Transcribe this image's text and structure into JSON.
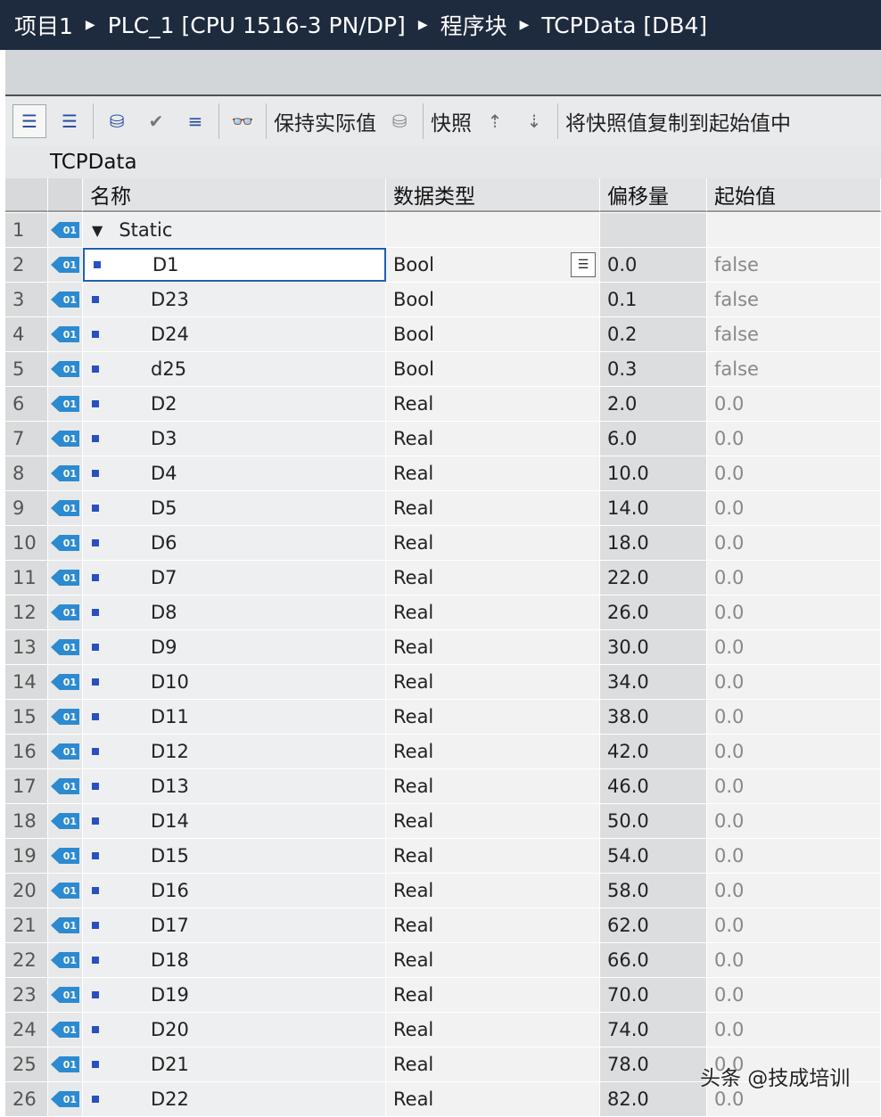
{
  "breadcrumb": [
    "项目1",
    "PLC_1 [CPU 1516-3 PN/DP]",
    "程序块",
    "TCPData [DB4]"
  ],
  "toolbar": {
    "keep_actual": "保持实际值",
    "snapshot": "快照",
    "copy_snapshot": "将快照值复制到起始值中"
  },
  "block_name": "TCPData",
  "columns": {
    "name": "名称",
    "type": "数据类型",
    "offset": "偏移量",
    "start": "起始值"
  },
  "rows": [
    {
      "n": "1",
      "name": "Static",
      "type": "",
      "offset": "",
      "start": ""
    },
    {
      "n": "2",
      "name": "D1",
      "type": "Bool",
      "offset": "0.0",
      "start": "false"
    },
    {
      "n": "3",
      "name": "D23",
      "type": "Bool",
      "offset": "0.1",
      "start": "false"
    },
    {
      "n": "4",
      "name": "D24",
      "type": "Bool",
      "offset": "0.2",
      "start": "false"
    },
    {
      "n": "5",
      "name": "d25",
      "type": "Bool",
      "offset": "0.3",
      "start": "false"
    },
    {
      "n": "6",
      "name": "D2",
      "type": "Real",
      "offset": "2.0",
      "start": "0.0"
    },
    {
      "n": "7",
      "name": "D3",
      "type": "Real",
      "offset": "6.0",
      "start": "0.0"
    },
    {
      "n": "8",
      "name": "D4",
      "type": "Real",
      "offset": "10.0",
      "start": "0.0"
    },
    {
      "n": "9",
      "name": "D5",
      "type": "Real",
      "offset": "14.0",
      "start": "0.0"
    },
    {
      "n": "10",
      "name": "D6",
      "type": "Real",
      "offset": "18.0",
      "start": "0.0"
    },
    {
      "n": "11",
      "name": "D7",
      "type": "Real",
      "offset": "22.0",
      "start": "0.0"
    },
    {
      "n": "12",
      "name": "D8",
      "type": "Real",
      "offset": "26.0",
      "start": "0.0"
    },
    {
      "n": "13",
      "name": "D9",
      "type": "Real",
      "offset": "30.0",
      "start": "0.0"
    },
    {
      "n": "14",
      "name": "D10",
      "type": "Real",
      "offset": "34.0",
      "start": "0.0"
    },
    {
      "n": "15",
      "name": "D11",
      "type": "Real",
      "offset": "38.0",
      "start": "0.0"
    },
    {
      "n": "16",
      "name": "D12",
      "type": "Real",
      "offset": "42.0",
      "start": "0.0"
    },
    {
      "n": "17",
      "name": "D13",
      "type": "Real",
      "offset": "46.0",
      "start": "0.0"
    },
    {
      "n": "18",
      "name": "D14",
      "type": "Real",
      "offset": "50.0",
      "start": "0.0"
    },
    {
      "n": "19",
      "name": "D15",
      "type": "Real",
      "offset": "54.0",
      "start": "0.0"
    },
    {
      "n": "20",
      "name": "D16",
      "type": "Real",
      "offset": "58.0",
      "start": "0.0"
    },
    {
      "n": "21",
      "name": "D17",
      "type": "Real",
      "offset": "62.0",
      "start": "0.0"
    },
    {
      "n": "22",
      "name": "D18",
      "type": "Real",
      "offset": "66.0",
      "start": "0.0"
    },
    {
      "n": "23",
      "name": "D19",
      "type": "Real",
      "offset": "70.0",
      "start": "0.0"
    },
    {
      "n": "24",
      "name": "D20",
      "type": "Real",
      "offset": "74.0",
      "start": "0.0"
    },
    {
      "n": "25",
      "name": "D21",
      "type": "Real",
      "offset": "78.0",
      "start": "0.0"
    },
    {
      "n": "26",
      "name": "D22",
      "type": "Real",
      "offset": "82.0",
      "start": "0.0"
    }
  ],
  "tag_icon_text": "01",
  "watermark": "头条 @技成培训"
}
